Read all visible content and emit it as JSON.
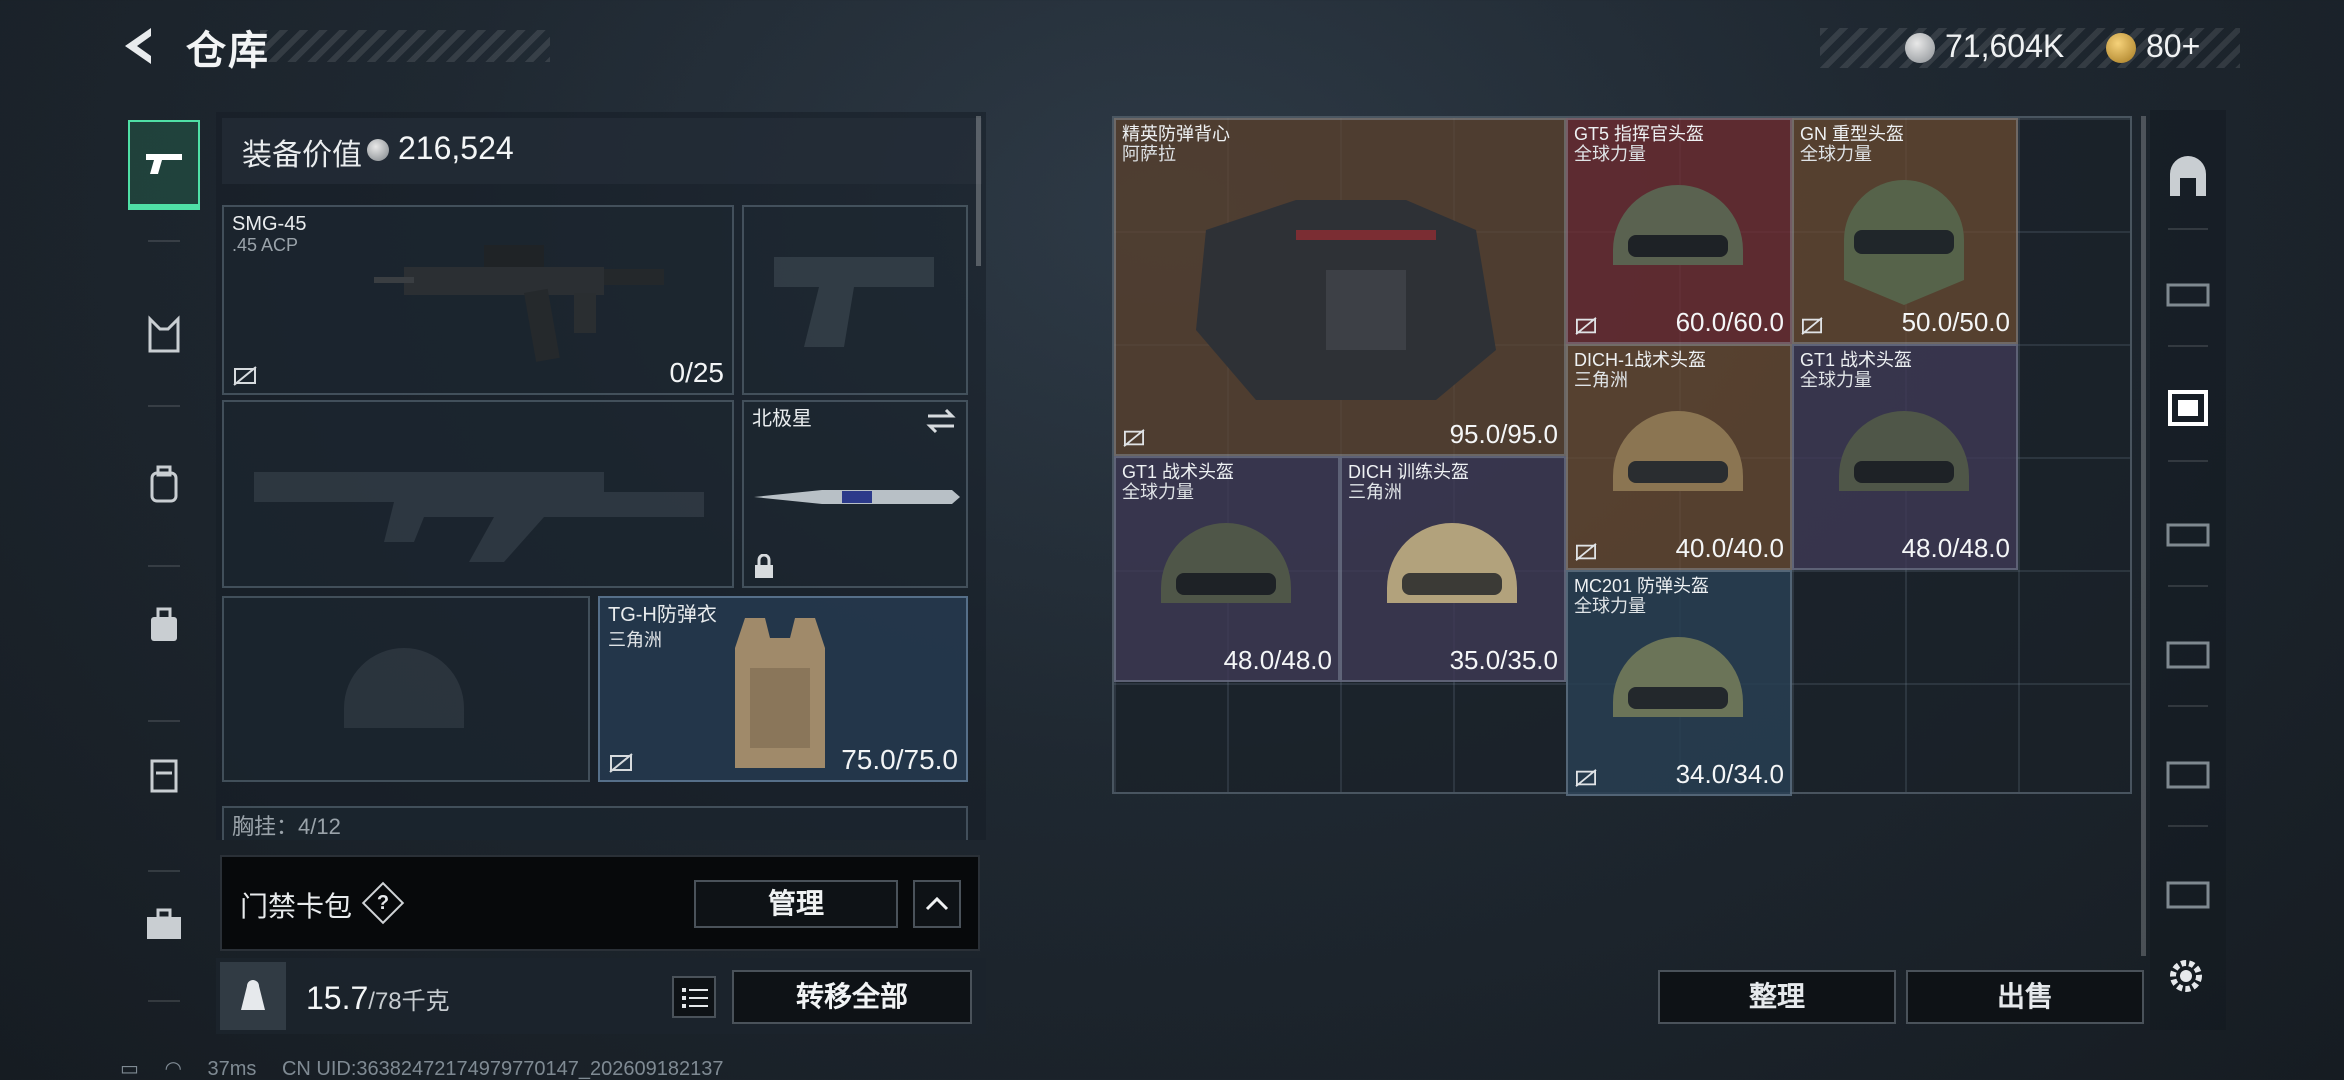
{
  "header": {
    "title": "仓库"
  },
  "currency": {
    "coin_amount": "71,604K",
    "ticket_amount": "80+"
  },
  "loadout": {
    "equip_value_label": "装备价值",
    "equip_value": "216,524",
    "primary_weapon": {
      "name": "SMG-45",
      "ammo_type": ".45 ACP",
      "ammo_count": "0/25"
    },
    "melee": {
      "name": "北极星"
    },
    "armor": {
      "name": "TG-H防弹衣",
      "origin": "三角洲",
      "durability": "75.0/75.0"
    },
    "chest_rig_label": "胸挂：4/12"
  },
  "keycard": {
    "label": "门禁卡包",
    "help": "?",
    "manage_label": "管理"
  },
  "bottom": {
    "weight_value": "15.7",
    "weight_max": "/78千克",
    "transfer_label": "转移全部"
  },
  "storage": {
    "items": [
      {
        "name": "精英防弹背心",
        "origin": "阿萨拉",
        "durability": "95.0/95.0",
        "color": "#5f4632"
      },
      {
        "name": "GT5 指挥官头盔",
        "origin": "全球力量",
        "durability": "60.0/60.0",
        "color": "#6e2d32"
      },
      {
        "name": "GN 重型头盔",
        "origin": "全球力量",
        "durability": "50.0/50.0",
        "color": "#694b32"
      },
      {
        "name": "DICH-1战术头盔",
        "origin": "三角洲",
        "durability": "40.0/40.0",
        "color": "#694b32"
      },
      {
        "name": "GT1 战术头盔",
        "origin": "全球力量",
        "durability": "48.0/48.0",
        "color": "#3e3a55"
      },
      {
        "name": "GT1 战术头盔",
        "origin": "全球力量",
        "durability": "48.0/48.0",
        "color": "#3e3a55"
      },
      {
        "name": "DICH 训练头盔",
        "origin": "三角洲",
        "durability": "35.0/35.0",
        "color": "#3e3a55"
      },
      {
        "name": "MC201 防弹头盔",
        "origin": "全球力量",
        "durability": "34.0/34.0",
        "color": "#283e52"
      }
    ],
    "sort_label": "整理",
    "sell_label": "出售"
  },
  "status": {
    "ping": "37ms",
    "uid": "CN UID:36382472174979770147_202609182137"
  }
}
